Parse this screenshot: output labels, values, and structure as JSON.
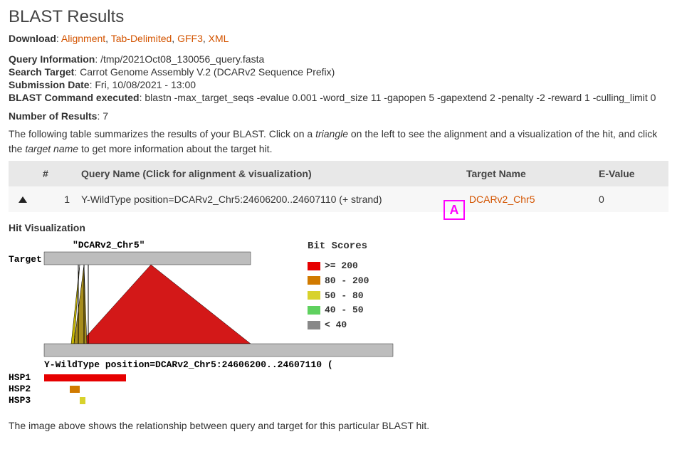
{
  "title": "BLAST Results",
  "download": {
    "label": "Download",
    "links": [
      "Alignment",
      "Tab-Delimited",
      "GFF3",
      "XML"
    ],
    "sep": ", "
  },
  "meta": {
    "query_info_label": "Query Information",
    "query_info_value": ": /tmp/2021Oct08_130056_query.fasta",
    "search_target_label": "Search Target",
    "search_target_value": ": Carrot Genome Assembly V.2 (DCARv2 Sequence Prefix)",
    "submission_date_label": "Submission Date",
    "submission_date_value": ": Fri, 10/08/2021 - 13:00",
    "blast_cmd_label": "BLAST Command executed",
    "blast_cmd_value": ": blastn -max_target_seqs -evalue 0.001 -word_size 11 -gapopen 5 -gapextend 2 -penalty -2 -reward 1 -culling_limit 0",
    "num_results_label": "Number of Results",
    "num_results_value": ": 7"
  },
  "intro": {
    "part1": "The following table summarizes the results of your BLAST. Click on a ",
    "em1": "triangle",
    "part2": " on the left to see the alignment and a visualization of the hit, and click the ",
    "em2": "target name",
    "part3": " to get more information about the target hit."
  },
  "table": {
    "headers": {
      "num": "#",
      "query": "Query Name (Click for alignment & visualization)",
      "target": "Target Name",
      "evalue": "E-Value"
    },
    "rows": [
      {
        "num": "1",
        "query": "Y-WildType position=DCARv2_Chr5:24606200..24607110 (+ strand)",
        "target": "DCARv2_Chr5",
        "evalue": "0"
      }
    ]
  },
  "annotation": {
    "letter": "A"
  },
  "viz": {
    "title": "Hit Visualization",
    "target_label": "Target",
    "chr_label": "\"DCARv2_Chr5\"",
    "query_label": "Y-WildType position=DCARv2_Chr5:24606200..24607110 (",
    "hsp_labels": [
      "HSP1",
      "HSP2",
      "HSP3"
    ]
  },
  "legend": {
    "title": "Bit Scores",
    "items": [
      {
        "color": "#e60000",
        "label": ">= 200"
      },
      {
        "color": "#d17a00",
        "label": "80 - 200"
      },
      {
        "color": "#d8d22c",
        "label": "50 - 80"
      },
      {
        "color": "#5fd15f",
        "label": "40 - 50"
      },
      {
        "color": "#888888",
        "label": "< 40"
      }
    ]
  },
  "chart_data": {
    "type": "area",
    "title": "BLAST hit alignment: query vs DCARv2_Chr5",
    "target_name": "DCARv2_Chr5",
    "query_name": "Y-WildType position=DCARv2_Chr5:24606200..24607110",
    "hsps": [
      {
        "name": "HSP1",
        "bit_score_range": ">= 200",
        "color": "#e60000",
        "query_start_frac": 0.0,
        "query_end_frac": 0.32
      },
      {
        "name": "HSP2",
        "bit_score_range": "80 - 200",
        "color": "#d17a00",
        "query_start_frac": 0.1,
        "query_end_frac": 0.14
      },
      {
        "name": "HSP3",
        "bit_score_range": "50 - 80",
        "color": "#d8d22c",
        "query_start_frac": 0.17,
        "query_end_frac": 0.19
      }
    ]
  },
  "caption": "The image above shows the relationship between query and target for this particular BLAST hit."
}
